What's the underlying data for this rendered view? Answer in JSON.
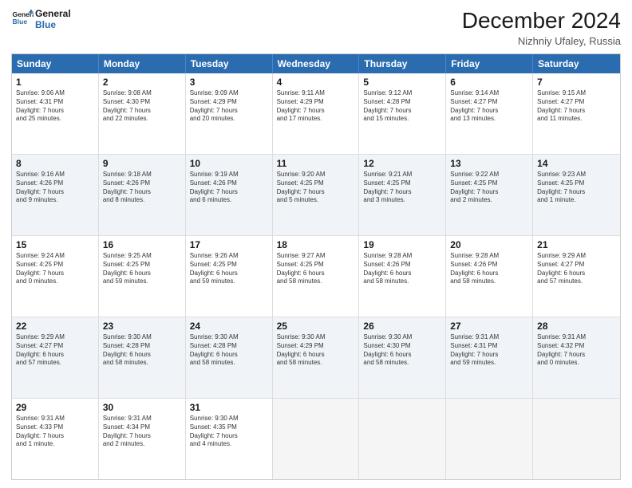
{
  "header": {
    "logo_line1": "General",
    "logo_line2": "Blue",
    "month_title": "December 2024",
    "location": "Nizhniy Ufaley, Russia"
  },
  "days_of_week": [
    "Sunday",
    "Monday",
    "Tuesday",
    "Wednesday",
    "Thursday",
    "Friday",
    "Saturday"
  ],
  "rows": [
    [
      {
        "day": "1",
        "lines": [
          "Sunrise: 9:06 AM",
          "Sunset: 4:31 PM",
          "Daylight: 7 hours",
          "and 25 minutes."
        ]
      },
      {
        "day": "2",
        "lines": [
          "Sunrise: 9:08 AM",
          "Sunset: 4:30 PM",
          "Daylight: 7 hours",
          "and 22 minutes."
        ]
      },
      {
        "day": "3",
        "lines": [
          "Sunrise: 9:09 AM",
          "Sunset: 4:29 PM",
          "Daylight: 7 hours",
          "and 20 minutes."
        ]
      },
      {
        "day": "4",
        "lines": [
          "Sunrise: 9:11 AM",
          "Sunset: 4:29 PM",
          "Daylight: 7 hours",
          "and 17 minutes."
        ]
      },
      {
        "day": "5",
        "lines": [
          "Sunrise: 9:12 AM",
          "Sunset: 4:28 PM",
          "Daylight: 7 hours",
          "and 15 minutes."
        ]
      },
      {
        "day": "6",
        "lines": [
          "Sunrise: 9:14 AM",
          "Sunset: 4:27 PM",
          "Daylight: 7 hours",
          "and 13 minutes."
        ]
      },
      {
        "day": "7",
        "lines": [
          "Sunrise: 9:15 AM",
          "Sunset: 4:27 PM",
          "Daylight: 7 hours",
          "and 11 minutes."
        ]
      }
    ],
    [
      {
        "day": "8",
        "lines": [
          "Sunrise: 9:16 AM",
          "Sunset: 4:26 PM",
          "Daylight: 7 hours",
          "and 9 minutes."
        ]
      },
      {
        "day": "9",
        "lines": [
          "Sunrise: 9:18 AM",
          "Sunset: 4:26 PM",
          "Daylight: 7 hours",
          "and 8 minutes."
        ]
      },
      {
        "day": "10",
        "lines": [
          "Sunrise: 9:19 AM",
          "Sunset: 4:26 PM",
          "Daylight: 7 hours",
          "and 6 minutes."
        ]
      },
      {
        "day": "11",
        "lines": [
          "Sunrise: 9:20 AM",
          "Sunset: 4:25 PM",
          "Daylight: 7 hours",
          "and 5 minutes."
        ]
      },
      {
        "day": "12",
        "lines": [
          "Sunrise: 9:21 AM",
          "Sunset: 4:25 PM",
          "Daylight: 7 hours",
          "and 3 minutes."
        ]
      },
      {
        "day": "13",
        "lines": [
          "Sunrise: 9:22 AM",
          "Sunset: 4:25 PM",
          "Daylight: 7 hours",
          "and 2 minutes."
        ]
      },
      {
        "day": "14",
        "lines": [
          "Sunrise: 9:23 AM",
          "Sunset: 4:25 PM",
          "Daylight: 7 hours",
          "and 1 minute."
        ]
      }
    ],
    [
      {
        "day": "15",
        "lines": [
          "Sunrise: 9:24 AM",
          "Sunset: 4:25 PM",
          "Daylight: 7 hours",
          "and 0 minutes."
        ]
      },
      {
        "day": "16",
        "lines": [
          "Sunrise: 9:25 AM",
          "Sunset: 4:25 PM",
          "Daylight: 6 hours",
          "and 59 minutes."
        ]
      },
      {
        "day": "17",
        "lines": [
          "Sunrise: 9:26 AM",
          "Sunset: 4:25 PM",
          "Daylight: 6 hours",
          "and 59 minutes."
        ]
      },
      {
        "day": "18",
        "lines": [
          "Sunrise: 9:27 AM",
          "Sunset: 4:25 PM",
          "Daylight: 6 hours",
          "and 58 minutes."
        ]
      },
      {
        "day": "19",
        "lines": [
          "Sunrise: 9:28 AM",
          "Sunset: 4:26 PM",
          "Daylight: 6 hours",
          "and 58 minutes."
        ]
      },
      {
        "day": "20",
        "lines": [
          "Sunrise: 9:28 AM",
          "Sunset: 4:26 PM",
          "Daylight: 6 hours",
          "and 58 minutes."
        ]
      },
      {
        "day": "21",
        "lines": [
          "Sunrise: 9:29 AM",
          "Sunset: 4:27 PM",
          "Daylight: 6 hours",
          "and 57 minutes."
        ]
      }
    ],
    [
      {
        "day": "22",
        "lines": [
          "Sunrise: 9:29 AM",
          "Sunset: 4:27 PM",
          "Daylight: 6 hours",
          "and 57 minutes."
        ]
      },
      {
        "day": "23",
        "lines": [
          "Sunrise: 9:30 AM",
          "Sunset: 4:28 PM",
          "Daylight: 6 hours",
          "and 58 minutes."
        ]
      },
      {
        "day": "24",
        "lines": [
          "Sunrise: 9:30 AM",
          "Sunset: 4:28 PM",
          "Daylight: 6 hours",
          "and 58 minutes."
        ]
      },
      {
        "day": "25",
        "lines": [
          "Sunrise: 9:30 AM",
          "Sunset: 4:29 PM",
          "Daylight: 6 hours",
          "and 58 minutes."
        ]
      },
      {
        "day": "26",
        "lines": [
          "Sunrise: 9:30 AM",
          "Sunset: 4:30 PM",
          "Daylight: 6 hours",
          "and 58 minutes."
        ]
      },
      {
        "day": "27",
        "lines": [
          "Sunrise: 9:31 AM",
          "Sunset: 4:31 PM",
          "Daylight: 7 hours",
          "and 59 minutes."
        ]
      },
      {
        "day": "28",
        "lines": [
          "Sunrise: 9:31 AM",
          "Sunset: 4:32 PM",
          "Daylight: 7 hours",
          "and 0 minutes."
        ]
      }
    ],
    [
      {
        "day": "29",
        "lines": [
          "Sunrise: 9:31 AM",
          "Sunset: 4:33 PM",
          "Daylight: 7 hours",
          "and 1 minute."
        ]
      },
      {
        "day": "30",
        "lines": [
          "Sunrise: 9:31 AM",
          "Sunset: 4:34 PM",
          "Daylight: 7 hours",
          "and 2 minutes."
        ]
      },
      {
        "day": "31",
        "lines": [
          "Sunrise: 9:30 AM",
          "Sunset: 4:35 PM",
          "Daylight: 7 hours",
          "and 4 minutes."
        ]
      },
      {
        "day": "",
        "lines": []
      },
      {
        "day": "",
        "lines": []
      },
      {
        "day": "",
        "lines": []
      },
      {
        "day": "",
        "lines": []
      }
    ]
  ]
}
